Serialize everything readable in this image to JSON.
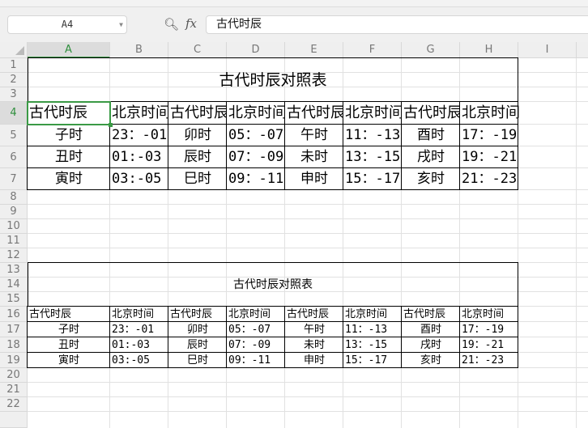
{
  "formula_bar": {
    "name_box": "A4",
    "zoom_icon": "zoom-icon",
    "fx_label": "fx",
    "formula": "古代时辰"
  },
  "columns": [
    "A",
    "B",
    "C",
    "D",
    "E",
    "F",
    "G",
    "H",
    "I"
  ],
  "selected": {
    "col": "A",
    "row": "4"
  },
  "rows": [
    "1",
    "2",
    "3",
    "4",
    "5",
    "6",
    "7",
    "8",
    "9",
    "10",
    "11",
    "12",
    "13",
    "14",
    "15",
    "16",
    "17",
    "18",
    "19",
    "20",
    "21",
    "22"
  ],
  "table1": {
    "title": "古代时辰对照表",
    "header": [
      "古代时辰",
      "北京时间",
      "古代时辰",
      "北京时间",
      "古代时辰",
      "北京时间",
      "古代时辰",
      "北京时间"
    ],
    "rows": [
      [
        "子时",
        "23：-01",
        "卯时",
        "05：-07",
        "午时",
        "11：-13",
        "酉时",
        "17：-19"
      ],
      [
        "丑时",
        "01:-03",
        "辰时",
        "07：-09",
        "未时",
        "13：-15",
        "戌时",
        "19：-21"
      ],
      [
        "寅时",
        "03:-05",
        "巳时",
        "09：-11",
        "申时",
        "15：-17",
        "亥时",
        "21：-23"
      ]
    ]
  },
  "table2": {
    "title": "古代时辰对照表",
    "header": [
      "古代时辰",
      "北京时间",
      "古代时辰",
      "北京时间",
      "古代时辰",
      "北京时间",
      "古代时辰",
      "北京时间"
    ],
    "rows": [
      [
        "子时",
        "23：-01",
        "卯时",
        "05：-07",
        "午时",
        "11：-13",
        "酉时",
        "17：-19"
      ],
      [
        "丑时",
        "01:-03",
        "辰时",
        "07：-09",
        "未时",
        "13：-15",
        "戌时",
        "19：-21"
      ],
      [
        "寅时",
        "03:-05",
        "巳时",
        "09：-11",
        "申时",
        "15：-17",
        "亥时",
        "21：-23"
      ]
    ]
  }
}
